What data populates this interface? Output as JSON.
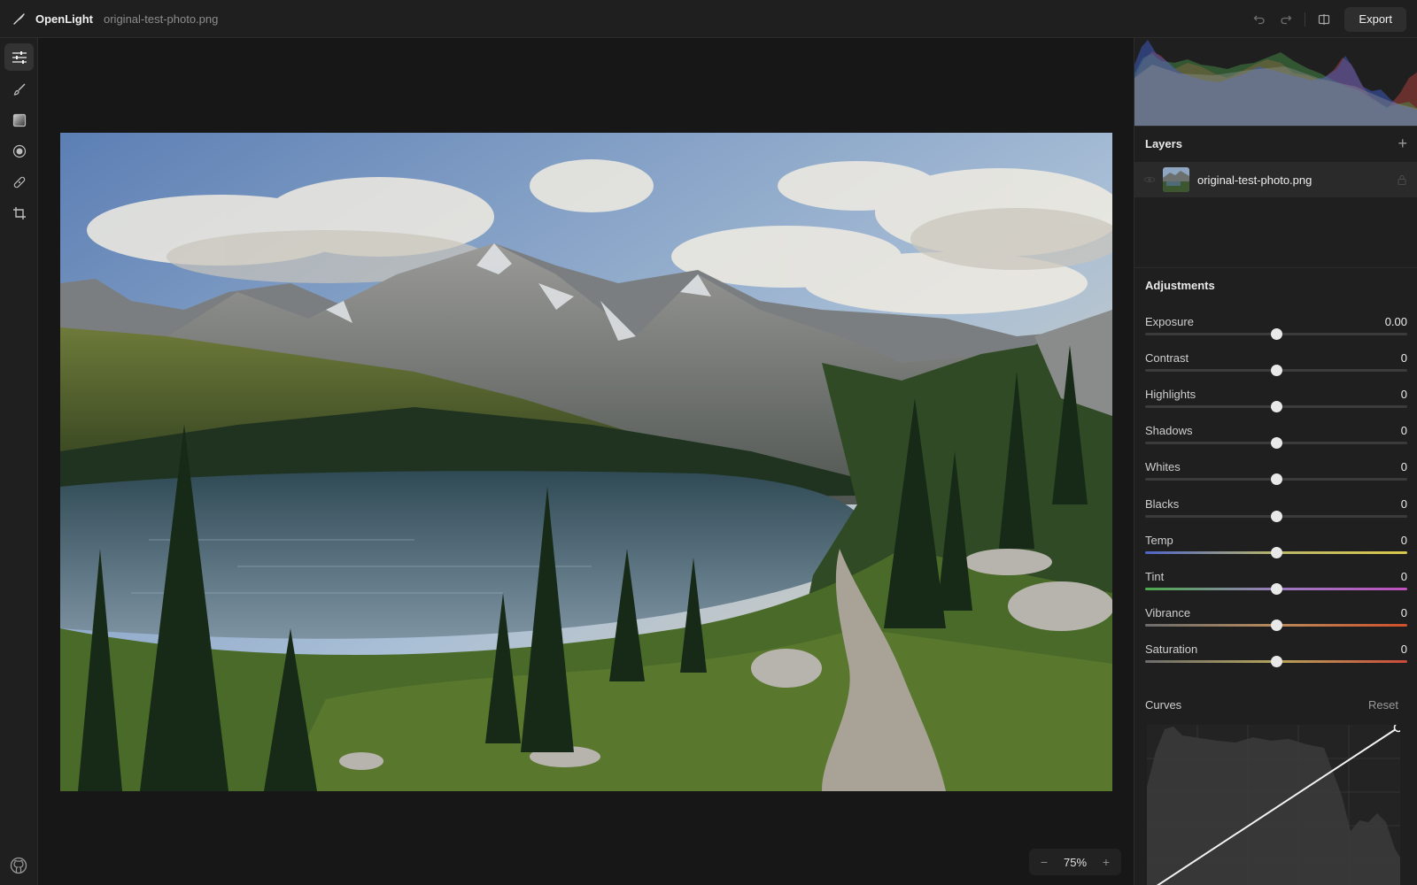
{
  "app": {
    "name": "OpenLight",
    "file_name": "original-test-photo.png",
    "logo_icon": "feather-pen-icon"
  },
  "toolbar": {
    "undo_icon": "undo-icon",
    "redo_icon": "redo-icon",
    "compare_icon": "split-compare-icon",
    "export_label": "Export"
  },
  "tools": [
    {
      "name": "adjust",
      "icon": "sliders-icon",
      "active": true
    },
    {
      "name": "brush",
      "icon": "brush-icon",
      "active": false
    },
    {
      "name": "gradient",
      "icon": "gradient-icon",
      "active": false
    },
    {
      "name": "radial",
      "icon": "radial-icon",
      "active": false
    },
    {
      "name": "heal",
      "icon": "bandage-icon",
      "active": false
    },
    {
      "name": "crop",
      "icon": "crop-icon",
      "active": false
    }
  ],
  "canvas": {
    "zoom_value": "75%",
    "zoom_out": "−",
    "zoom_in": "+"
  },
  "layers": {
    "title": "Layers",
    "add_label": "+",
    "items": [
      {
        "name": "original-test-photo.png",
        "visible": true,
        "locked": true
      }
    ]
  },
  "adjustments": {
    "title": "Adjustments",
    "items": [
      {
        "label": "Exposure",
        "value": "0.00",
        "level": 0.5,
        "track": "neutral"
      },
      {
        "label": "Contrast",
        "value": "0",
        "level": 0.5,
        "track": "neutral"
      },
      {
        "label": "Highlights",
        "value": "0",
        "level": 0.5,
        "track": "neutral"
      },
      {
        "label": "Shadows",
        "value": "0",
        "level": 0.5,
        "track": "neutral"
      },
      {
        "label": "Whites",
        "value": "0",
        "level": 0.5,
        "track": "neutral"
      },
      {
        "label": "Blacks",
        "value": "0",
        "level": 0.5,
        "track": "neutral"
      },
      {
        "label": "Temp",
        "value": "0",
        "level": 0.5,
        "track": "temp"
      },
      {
        "label": "Tint",
        "value": "0",
        "level": 0.5,
        "track": "tint"
      },
      {
        "label": "Vibrance",
        "value": "0",
        "level": 0.5,
        "track": "vibrance"
      },
      {
        "label": "Saturation",
        "value": "0",
        "level": 0.5,
        "track": "saturation"
      }
    ]
  },
  "curves": {
    "title": "Curves",
    "reset_label": "Reset"
  },
  "colors": {
    "accent": "#f2f2f2",
    "panel_bg": "#1f1f1f",
    "canvas_bg": "#171717",
    "histogram_red": "#c0453e",
    "histogram_green": "#4a9a4a",
    "histogram_blue": "#3f5fc8"
  }
}
